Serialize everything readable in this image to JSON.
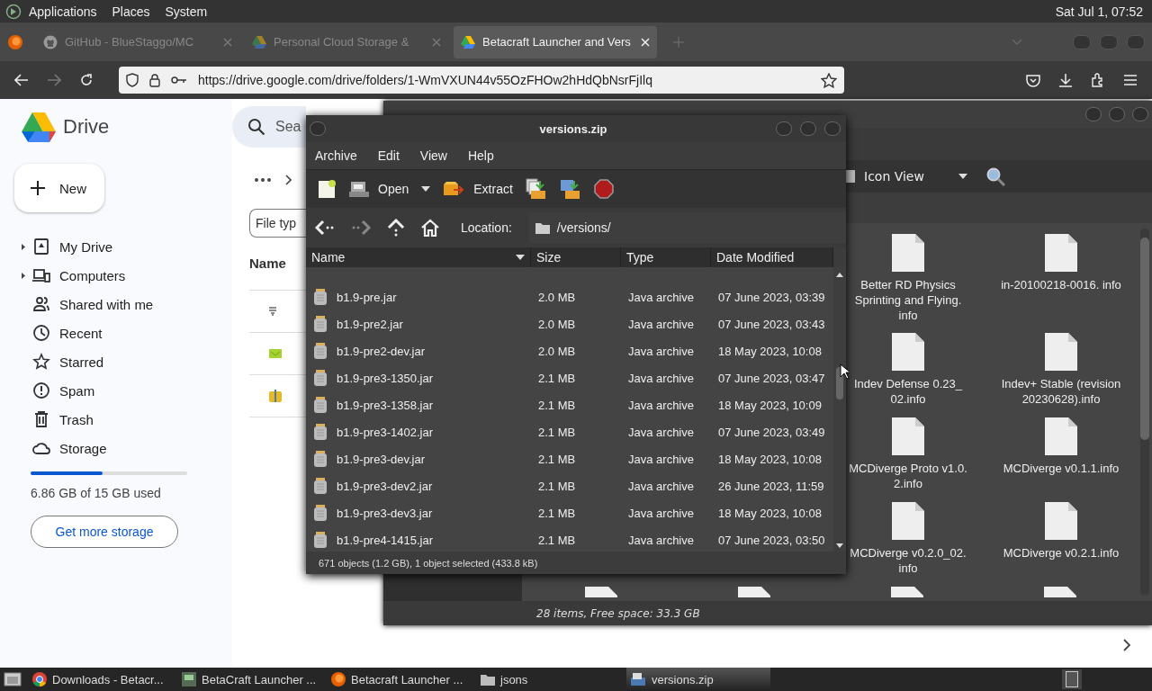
{
  "top_panel": {
    "menus": [
      "Applications",
      "Places",
      "System"
    ],
    "clock": "Sat Jul 1, 07:52"
  },
  "browser": {
    "tabs": [
      {
        "title": "GitHub - BlueStaggo/MC",
        "selected": false,
        "kind": "github"
      },
      {
        "title": "Personal Cloud Storage &",
        "selected": false,
        "kind": "drive"
      },
      {
        "title": "Betacraft Launcher and Vers",
        "selected": true,
        "kind": "drive"
      }
    ],
    "url": "https://drive.google.com/drive/folders/1-WmVXUN44v55OzFHOw2hHdQbNsrFjIlq"
  },
  "drive": {
    "logo_text": "Drive",
    "new_button": "New",
    "search_placeholder": "Sea",
    "filter_chip": "File typ",
    "column_header": "Name",
    "nav": [
      {
        "label": "My Drive",
        "kind": "mydrive",
        "expandable": true
      },
      {
        "label": "Computers",
        "kind": "computers",
        "expandable": true
      },
      {
        "label": "Shared with me",
        "kind": "shared",
        "expandable": false
      },
      {
        "label": "Recent",
        "kind": "recent",
        "expandable": false
      },
      {
        "label": "Starred",
        "kind": "starred",
        "expandable": false
      },
      {
        "label": "Spam",
        "kind": "spam",
        "expandable": false
      },
      {
        "label": "Trash",
        "kind": "trash",
        "expandable": false
      },
      {
        "label": "Storage",
        "kind": "storage",
        "expandable": false
      }
    ],
    "storage": {
      "level": 0.457,
      "text": "6.86 GB of 15 GB used"
    },
    "get_storage_button": "Get more storage",
    "rows": [
      {
        "kind": "doc"
      },
      {
        "kind": "image"
      },
      {
        "kind": "archive"
      }
    ]
  },
  "file_manager": {
    "view_mode": "Icon View",
    "items": [
      {
        "label": "Better RD Physics Sprinting and Flying. info"
      },
      {
        "label": "in-20100218-0016. info"
      },
      {
        "label": "Indev Defense 0.23_ 02.info"
      },
      {
        "label": "Indev+ Stable (revision 20230628).info"
      },
      {
        "label": "MCDiverge Proto v1.0. 2.info"
      },
      {
        "label": "MCDiverge v0.1.1.info"
      },
      {
        "label": "MCDiverge v0.2.0_02. info"
      },
      {
        "label": "MCDiverge v0.2.1.info"
      }
    ],
    "status": "28 items, Free space: 33.3 GB"
  },
  "archive_window": {
    "title": "versions.zip",
    "menus": [
      "Archive",
      "Edit",
      "View",
      "Help"
    ],
    "open_button": "Open",
    "extract_button": "Extract",
    "location_label": "Location:",
    "location": "/versions/",
    "columns": [
      "Name",
      "Size",
      "Type",
      "Date Modified"
    ],
    "rows": [
      {
        "name": "b1.9-pre.jar",
        "size": "2.0 MB",
        "type": "Java archive",
        "modified": "07 June 2023, 03:39"
      },
      {
        "name": "b1.9-pre2.jar",
        "size": "2.0 MB",
        "type": "Java archive",
        "modified": "07 June 2023, 03:43"
      },
      {
        "name": "b1.9-pre2-dev.jar",
        "size": "2.0 MB",
        "type": "Java archive",
        "modified": "18 May 2023, 10:08"
      },
      {
        "name": "b1.9-pre3-1350.jar",
        "size": "2.1 MB",
        "type": "Java archive",
        "modified": "07 June 2023, 03:47"
      },
      {
        "name": "b1.9-pre3-1358.jar",
        "size": "2.1 MB",
        "type": "Java archive",
        "modified": "18 May 2023, 10:09"
      },
      {
        "name": "b1.9-pre3-1402.jar",
        "size": "2.1 MB",
        "type": "Java archive",
        "modified": "07 June 2023, 03:49"
      },
      {
        "name": "b1.9-pre3-dev.jar",
        "size": "2.1 MB",
        "type": "Java archive",
        "modified": "18 May 2023, 10:08"
      },
      {
        "name": "b1.9-pre3-dev2.jar",
        "size": "2.1 MB",
        "type": "Java archive",
        "modified": "26 June 2023, 11:59"
      },
      {
        "name": "b1.9-pre3-dev3.jar",
        "size": "2.1 MB",
        "type": "Java archive",
        "modified": "18 May 2023, 10:08"
      },
      {
        "name": "b1.9-pre4-1415.jar",
        "size": "2.1 MB",
        "type": "Java archive",
        "modified": "07 June 2023, 03:50"
      }
    ],
    "status": "671 objects (1.2 GB), 1 object selected (433.8 kB)"
  },
  "taskbar": {
    "items": [
      {
        "label": "Downloads - Betacr...",
        "kind": "chrome",
        "selected": false
      },
      {
        "label": "BetaCraft Launcher ...",
        "kind": "app",
        "selected": false
      },
      {
        "label": "Betacraft Launcher ...",
        "kind": "firefox",
        "selected": false
      },
      {
        "label": "jsons",
        "kind": "folder",
        "selected": false
      },
      {
        "label": "versions.zip",
        "kind": "archive",
        "selected": true
      }
    ]
  }
}
